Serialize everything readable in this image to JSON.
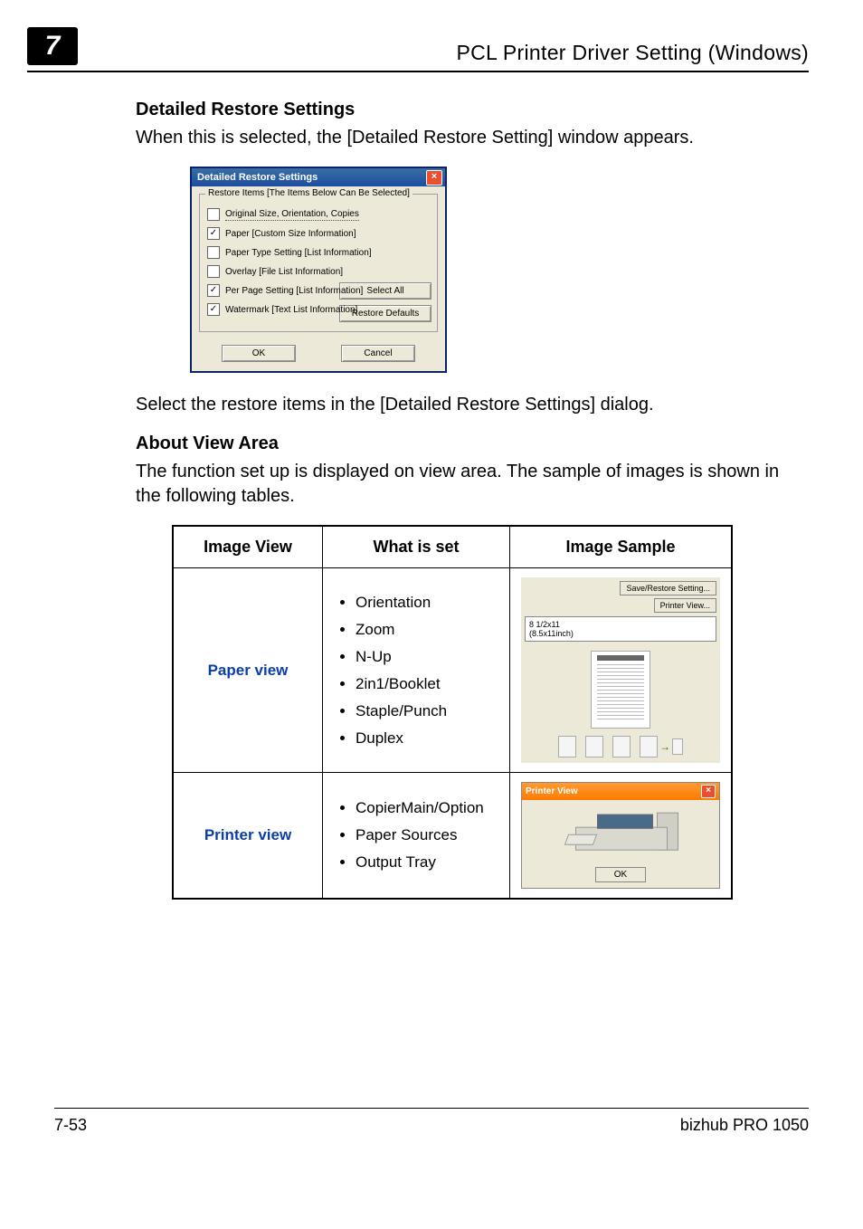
{
  "header": {
    "chapter_number": "7",
    "section_title": "PCL Printer Driver Setting (Windows)"
  },
  "section1": {
    "heading": "Detailed Restore Settings",
    "intro": "When this is selected, the [Detailed Restore Setting] window appears.",
    "after": "Select the restore items in the [Detailed Restore Settings] dialog."
  },
  "dialog": {
    "title": "Detailed Restore Settings",
    "legend": "Restore Items [The Items Below Can Be Selected]",
    "items": [
      {
        "label": "Original Size, Orientation, Copies",
        "checked": false,
        "dotted": true
      },
      {
        "label": "Paper [Custom Size Information]",
        "checked": true
      },
      {
        "label": "Paper Type Setting [List Information]",
        "checked": false
      },
      {
        "label": "Overlay [File List Information]",
        "checked": false
      },
      {
        "label": "Per Page Setting [List Information]",
        "checked": true
      },
      {
        "label": "Watermark [Text List Information]",
        "checked": true
      }
    ],
    "select_all": "Select All",
    "restore_defaults": "Restore Defaults",
    "ok": "OK",
    "cancel": "Cancel"
  },
  "section2": {
    "heading": "About View Area",
    "intro": "The function set up is displayed on view area. The sample of images is shown in the following tables."
  },
  "table": {
    "head": {
      "col1": "Image View",
      "col2": "What is set",
      "col3": "Image Sample"
    },
    "rows": [
      {
        "view": "Paper view",
        "items": [
          "Orientation",
          "Zoom",
          "N-Up",
          "2in1/Booklet",
          "Staple/Punch",
          "Duplex"
        ]
      },
      {
        "view": "Printer view",
        "items": [
          "CopierMain/Option",
          "Paper Sources",
          "Output Tray"
        ]
      }
    ]
  },
  "paper_sample": {
    "btn_save": "Save/Restore Setting...",
    "btn_printer_view": "Printer View...",
    "size1": "8 1/2x11",
    "size2": "(8.5x11inch)"
  },
  "printer_sample": {
    "title": "Printer View",
    "ok": "OK"
  },
  "footer": {
    "left": "7-53",
    "right": "bizhub PRO 1050"
  }
}
